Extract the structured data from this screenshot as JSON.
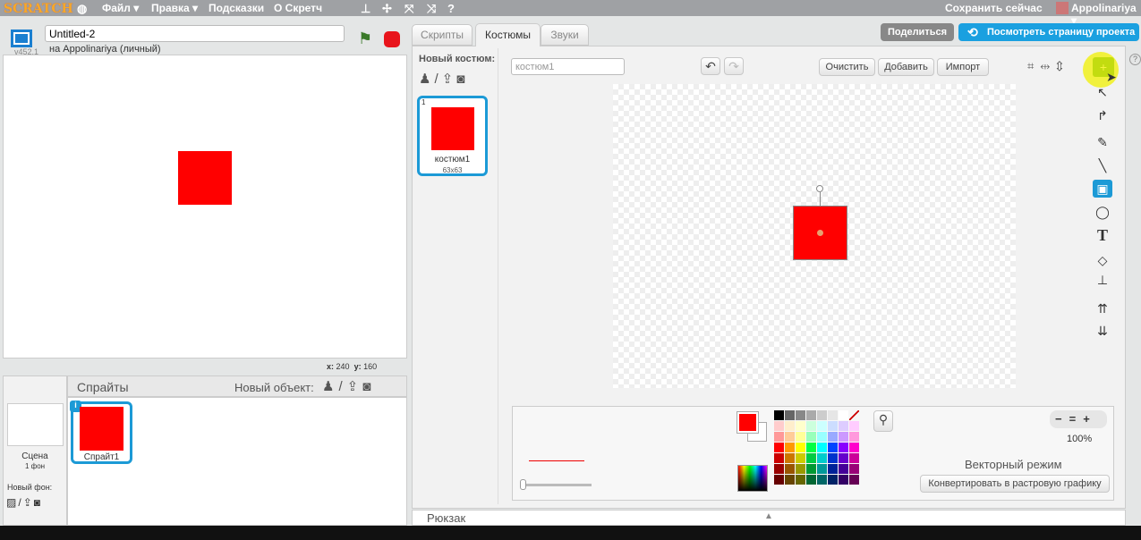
{
  "menu": {
    "logo": "SCRATCH",
    "file": "Файл ▾",
    "edit": "Правка ▾",
    "tips": "Подсказки",
    "about": "О Скретч",
    "save_now": "Сохранить сейчас",
    "user": "Appolinariya ▾"
  },
  "project": {
    "title": "Untitled-2",
    "owner": "на Appolinariya (личный)",
    "version": "v452.1"
  },
  "tabs": [
    "Скрипты",
    "Костюмы",
    "Звуки"
  ],
  "actions": {
    "share": "Поделиться",
    "see_page": "Посмотреть страницу проекта"
  },
  "stage": {
    "x_label": "x:",
    "x": "240",
    "y_label": "y:",
    "y": "160"
  },
  "sprites": {
    "header": "Спрайты",
    "new_object": "Новый объект:",
    "scene_label": "Сцена",
    "scene_bg": "1 фон",
    "new_bg": "Новый фон:",
    "items": [
      {
        "name": "Спрайт1"
      }
    ]
  },
  "costumes": {
    "new_costume": "Новый костюм:",
    "items": [
      {
        "num": "1",
        "name": "костюм1",
        "size": "63x63"
      }
    ]
  },
  "editor": {
    "costume_name": "костюм1",
    "clear": "Очистить",
    "add": "Добавить",
    "import": "Импорт",
    "zoom": "100%",
    "mode": "Векторный режим",
    "convert": "Конвертировать в растровую графику"
  },
  "backpack": "Рюкзак",
  "colors": {
    "fill": "#ff0000",
    "accent": "#1aa0e0"
  }
}
